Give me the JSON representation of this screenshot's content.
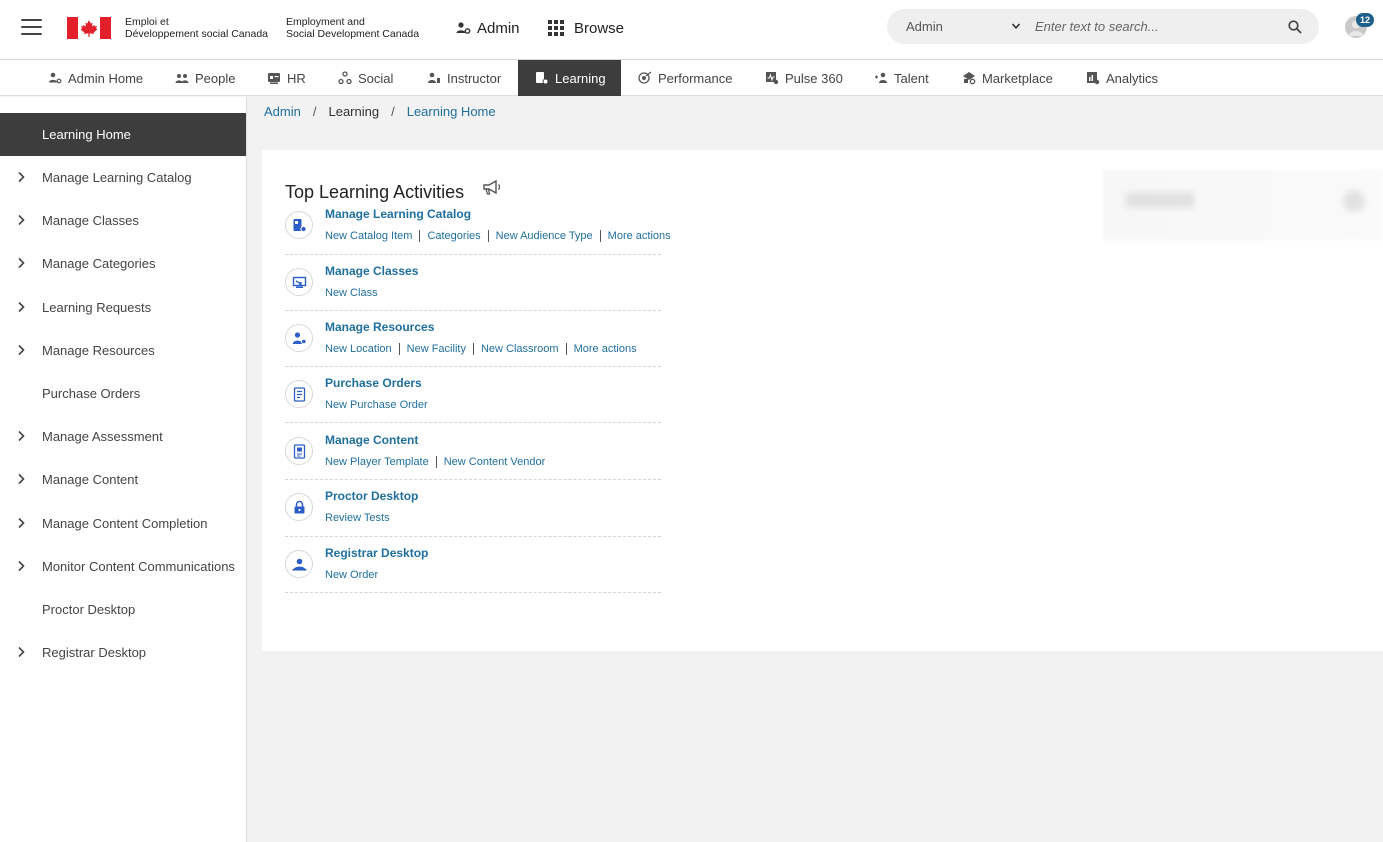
{
  "header": {
    "dept_fr_line1": "Emploi et",
    "dept_fr_line2": "Développement social Canada",
    "dept_en_line1": "Employment and",
    "dept_en_line2": "Social Development Canada",
    "admin_label": "Admin",
    "browse_label": "Browse",
    "search_scope": "Admin",
    "search_placeholder": "Enter text to search...",
    "notification_count": "12"
  },
  "module_nav": {
    "tabs": [
      {
        "label": "Admin Home",
        "icon": "admin-home-icon"
      },
      {
        "label": "People",
        "icon": "people-icon"
      },
      {
        "label": "HR",
        "icon": "hr-icon"
      },
      {
        "label": "Social",
        "icon": "social-icon"
      },
      {
        "label": "Instructor",
        "icon": "instructor-icon"
      },
      {
        "label": "Learning",
        "icon": "learning-icon",
        "active": true
      },
      {
        "label": "Performance",
        "icon": "performance-icon"
      },
      {
        "label": "Pulse 360",
        "icon": "pulse-icon"
      },
      {
        "label": "Talent",
        "icon": "talent-icon"
      },
      {
        "label": "Marketplace",
        "icon": "marketplace-icon"
      },
      {
        "label": "Analytics",
        "icon": "analytics-icon"
      }
    ]
  },
  "sidebar": {
    "items": [
      {
        "label": "Learning Home",
        "expandable": false,
        "active": true
      },
      {
        "label": "Manage Learning Catalog",
        "expandable": true
      },
      {
        "label": "Manage Classes",
        "expandable": true
      },
      {
        "label": "Manage Categories",
        "expandable": true
      },
      {
        "label": "Learning Requests",
        "expandable": true
      },
      {
        "label": "Manage Resources",
        "expandable": true
      },
      {
        "label": "Purchase Orders",
        "expandable": false
      },
      {
        "label": "Manage Assessment",
        "expandable": true
      },
      {
        "label": "Manage Content",
        "expandable": true
      },
      {
        "label": "Manage Content Completion",
        "expandable": true
      },
      {
        "label": "Monitor Content Communications",
        "expandable": true
      },
      {
        "label": "Proctor Desktop",
        "expandable": false
      },
      {
        "label": "Registrar Desktop",
        "expandable": true
      }
    ]
  },
  "breadcrumb": {
    "items": [
      "Admin",
      "Learning",
      "Learning Home"
    ],
    "separator": "/"
  },
  "main": {
    "card_title": "Top Learning Activities",
    "activities": [
      {
        "title": "Manage Learning Catalog",
        "icon": "catalog-icon",
        "links": [
          "New Catalog Item",
          "Categories",
          "New Audience Type",
          "More actions"
        ]
      },
      {
        "title": "Manage Classes",
        "icon": "classes-icon",
        "links": [
          "New Class"
        ]
      },
      {
        "title": "Manage Resources",
        "icon": "resources-icon",
        "links": [
          "New Location",
          "New Facility",
          "New Classroom",
          "More actions"
        ]
      },
      {
        "title": "Purchase Orders",
        "icon": "purchase-order-icon",
        "links": [
          "New Purchase Order"
        ]
      },
      {
        "title": "Manage Content",
        "icon": "content-icon",
        "links": [
          "New Player Template",
          "New Content Vendor"
        ]
      },
      {
        "title": "Proctor Desktop",
        "icon": "lock-icon",
        "links": [
          "Review Tests"
        ]
      },
      {
        "title": "Registrar Desktop",
        "icon": "registrar-icon",
        "links": [
          "New Order"
        ]
      }
    ]
  },
  "colors": {
    "link": "#1f6f9f",
    "active_tab_bg": "#3d3d3d",
    "icon_blue": "#2b5fc7",
    "flag_red": "#e3202a",
    "badge": "#1f5f8b"
  }
}
